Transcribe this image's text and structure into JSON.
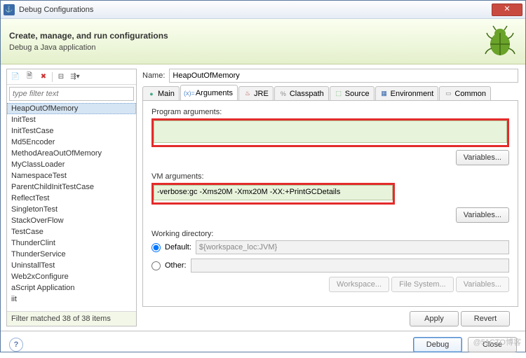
{
  "window": {
    "title": "Debug Configurations",
    "close": "✕"
  },
  "header": {
    "title": "Create, manage, and run configurations",
    "subtitle": "Debug a Java application"
  },
  "filter": {
    "placeholder": "type filter text"
  },
  "tree": {
    "items": [
      "HeapOutOfMemory",
      "InitTest",
      "InitTestCase",
      "Md5Encoder",
      "MethodAreaOutOfMemory",
      "MyClassLoader",
      "NamespaceTest",
      "ParentChildInitTestCase",
      "ReflectTest",
      "SingletonTest",
      "StackOverFlow",
      "TestCase",
      "ThunderClint",
      "ThunderService",
      "UninstallTest",
      "Web2xConfigure",
      "aScript Application",
      "iit"
    ],
    "selected": 0,
    "status": "Filter matched 38 of 38 items"
  },
  "form": {
    "name_label": "Name:",
    "name_value": "HeapOutOfMemory",
    "tabs": [
      "Main",
      "Arguments",
      "JRE",
      "Classpath",
      "Source",
      "Environment",
      "Common"
    ],
    "active_tab": 1,
    "prog_args_label": "Program arguments:",
    "prog_args_value": "",
    "vm_args_label": "VM arguments:",
    "vm_args_value": "-verbose:gc -Xms20M -Xmx20M -XX:+PrintGCDetails",
    "variables_btn": "Variables...",
    "wd_label": "Working directory:",
    "wd_default": "Default:",
    "wd_default_value": "${workspace_loc:JVM}",
    "wd_other": "Other:",
    "workspace_btn": "Workspace...",
    "filesystem_btn": "File System...",
    "apply": "Apply",
    "revert": "Revert"
  },
  "footer": {
    "debug": "Debug",
    "close": "Close"
  },
  "watermark": "@51CTO博客"
}
